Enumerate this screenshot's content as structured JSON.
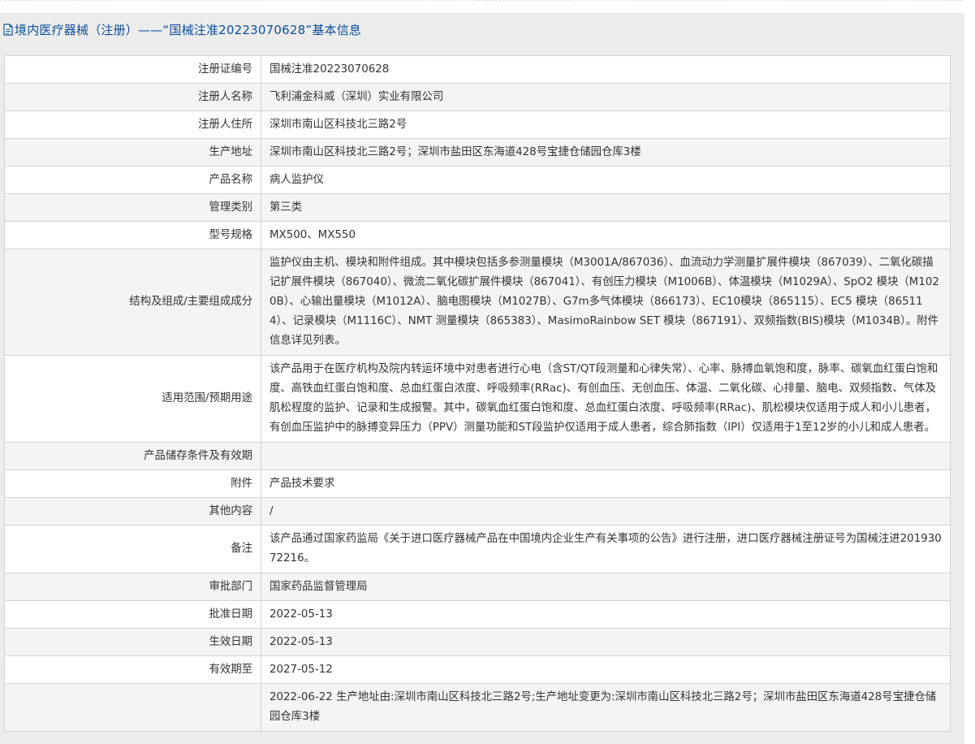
{
  "header": {
    "icon": "document-icon",
    "title": "境内医疗器械（注册）——“国械注准20223070628”基本信息"
  },
  "colors": {
    "title": "#0b4f9c",
    "panel_bg": "#ececec",
    "row_alt": "#f4f4f4",
    "border": "#d3d3d3",
    "text": "#333333"
  },
  "rows": [
    {
      "label": "注册证编号",
      "value": "国械注准20223070628"
    },
    {
      "label": "注册人名称",
      "value": "飞利浦金科威（深圳）实业有限公司"
    },
    {
      "label": "注册人住所",
      "value": "深圳市南山区科技北三路2号"
    },
    {
      "label": "生产地址",
      "value": "深圳市南山区科技北三路2号；深圳市盐田区东海道428号宝捷仓储园仓库3楼"
    },
    {
      "label": "产品名称",
      "value": "病人监护仪"
    },
    {
      "label": "管理类别",
      "value": "第三类"
    },
    {
      "label": "型号规格",
      "value": "MX500、MX550"
    },
    {
      "label": "结构及组成/主要组成成分",
      "value": "监护仪由主机、模块和附件组成。其中模块包括多参测量模块（M3001A/867036）、血流动力学测量扩展件模块（867039）、二氧化碳描记扩展件模块（867040）、微流二氧化碳扩展件模块（867041）、有创压力模块（M1006B）、体温模块（M1029A）、SpO2 模块（M1020B）、心输出量模块（M1012A）、脑电图模块（M1027B）、G7m多气体模块（866173）、EC10模块（865115）、EC5 模块（865114）、记录模块（M1116C）、NMT 测量模块（865383）、MasimoRainbow SET 模块（867191）、双频指数(BIS)模块（M1034B）。附件信息详见列表。"
    },
    {
      "label": "适用范围/预期用途",
      "value": "该产品用于在医疗机构及院内转运环境中对患者进行心电（含ST/QT段测量和心律失常）、心率、脉搏血氧饱和度，脉率、碳氧血红蛋白饱和度、高铁血红蛋白饱和度、总血红蛋白浓度、呼吸频率(RRac)、有创血压、无创血压、体温、二氧化碳、心排量、脑电、双频指数、气体及肌松程度的监护、记录和生成报警。其中，碳氧血红蛋白饱和度、总血红蛋白浓度、呼吸频率(RRac)、肌松模块仅适用于成人和小儿患者，有创血压监护中的脉搏变异压力（PPV）测量功能和ST段监护仅适用于成人患者，综合肺指数（IPI）仅适用于1至12岁的小儿和成人患者。"
    },
    {
      "label": "产品储存条件及有效期",
      "value": ""
    },
    {
      "label": "附件",
      "value": "产品技术要求"
    },
    {
      "label": "其他内容",
      "value": "/"
    },
    {
      "label": "备注",
      "value": "该产品通过国家药监局《关于进口医疗器械产品在中国境内企业生产有关事项的公告》进行注册，进口医疗器械注册证号为国械注进20193072216。"
    },
    {
      "label": "审批部门",
      "value": "国家药品监督管理局"
    },
    {
      "label": "批准日期",
      "value": "2022-05-13"
    },
    {
      "label": "生效日期",
      "value": "2022-05-13"
    },
    {
      "label": "有效期至",
      "value": "2027-05-12"
    },
    {
      "label": "",
      "value": "2022-06-22 生产地址由:深圳市南山区科技北三路2号;生产地址变更为:深圳市南山区科技北三路2号；深圳市盐田区东海道428号宝捷仓储园仓库3楼"
    }
  ]
}
